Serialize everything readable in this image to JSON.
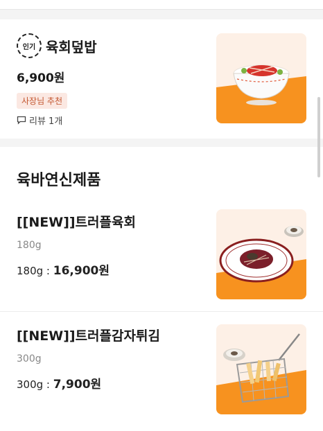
{
  "featured": {
    "badge": "인기",
    "name": "육회덮밥",
    "price": "6,900원",
    "recommend_tag": "사장님 추천",
    "review": "리뷰 1개"
  },
  "section": {
    "title": "육바연신제품",
    "items": [
      {
        "name": "[[NEW]]트러플육회",
        "weight": "180g",
        "price_prefix": "180g : ",
        "price": "16,900원"
      },
      {
        "name": "[[NEW]]트러플감자튀김",
        "weight": "300g",
        "price_prefix": "300g : ",
        "price": "7,900원"
      }
    ]
  },
  "colors": {
    "accent_orange": "#f7921f",
    "tag_bg": "#fbe8e2"
  },
  "icons": {
    "review": "speech-bubble-icon"
  }
}
